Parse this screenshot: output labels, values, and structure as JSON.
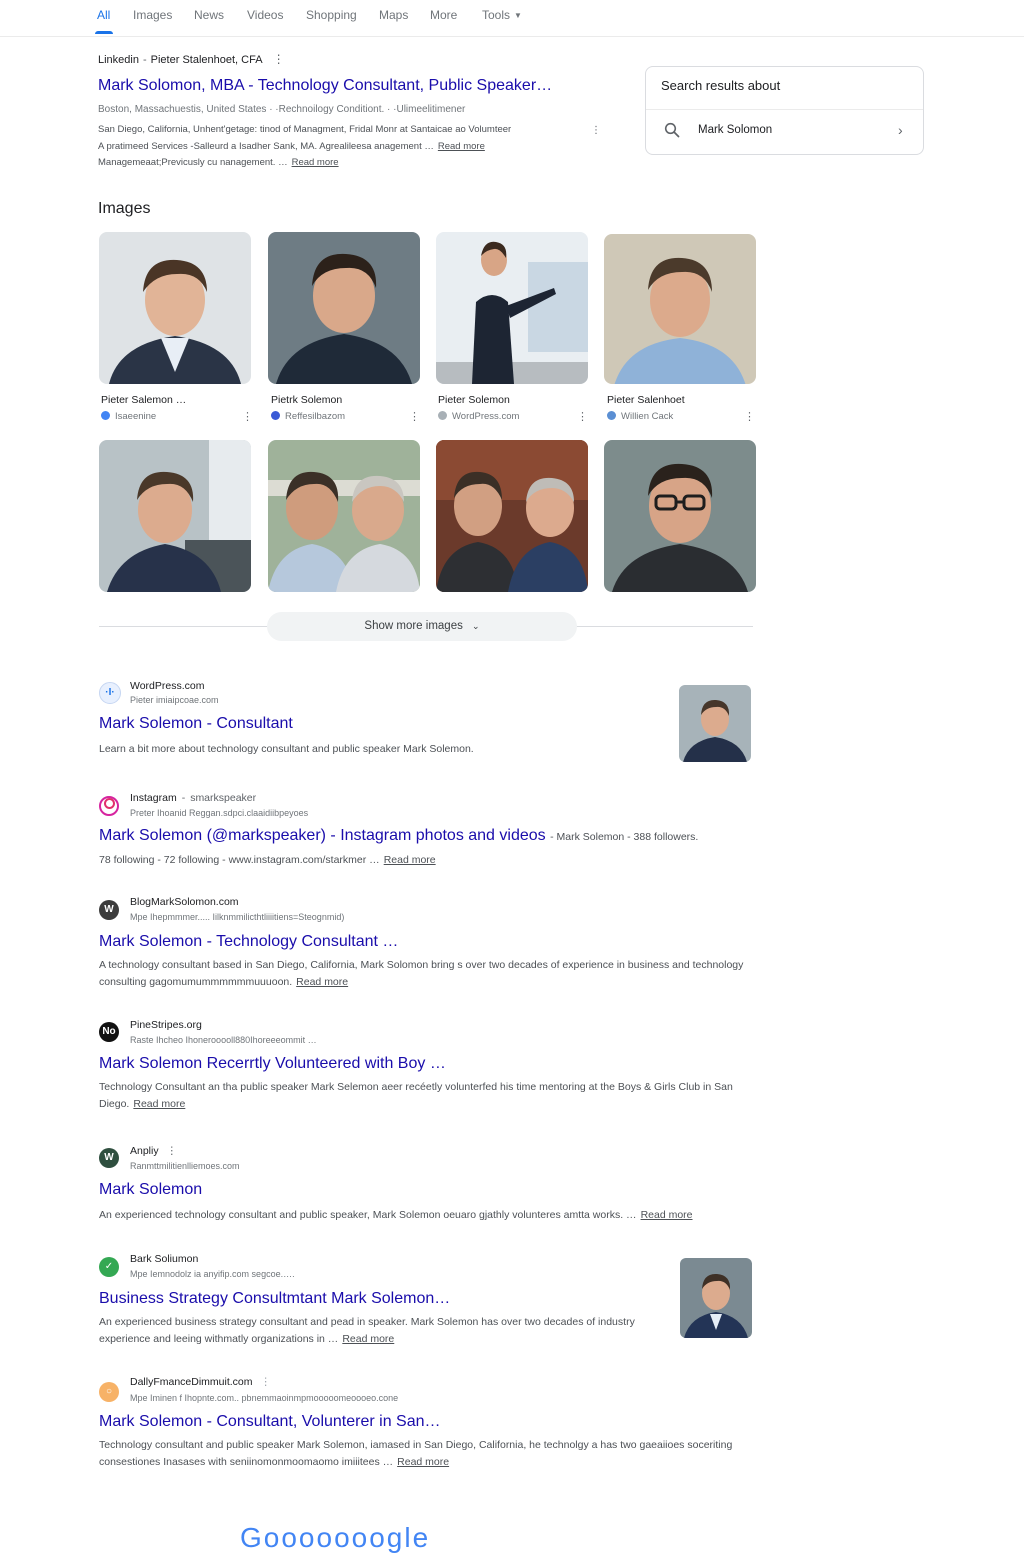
{
  "tabs": [
    {
      "label": "All"
    },
    {
      "label": "Images"
    },
    {
      "label": "News"
    },
    {
      "label": "Videos"
    },
    {
      "label": "Shopping"
    },
    {
      "label": "Maps"
    },
    {
      "label": "More"
    },
    {
      "label": "Tools"
    }
  ],
  "first_result": {
    "site": "Linkedin",
    "sub": "Pieter Stalenhoet, CFA",
    "title": "Mark Solomon, MBA - Technology Consultant, Public Speaker…",
    "meta": "Boston, Massachuestis, United States · ·Rechnoilogy Conditiont. · ·Ulimeelitimener",
    "line1": "San Diego, California, Unhent'getage: tinod of Managment, Fridal Monr at Santaicae ao Volumteer",
    "line2": "A pratimeed Services -Salleurd a Isadher Sank, MA. Agrealileesa anagement …",
    "line2_more": "Read more",
    "line3": "Managemeaat;Previcusly cu nanagement. …",
    "line3_more": "Read more"
  },
  "knowledge_box": {
    "title": "Search results about",
    "query": "Mark Solomon"
  },
  "images_section": {
    "title": "Images",
    "captions": [
      {
        "title": "Pieter Salemon …",
        "source": "Isaeenine"
      },
      {
        "title": "Pietrk Solemon",
        "source": "Reffesilbazom"
      },
      {
        "title": "Pieter Solemon",
        "source": "WordPress.com"
      },
      {
        "title": "Pieter Salenhoet",
        "source": "Willien Cack"
      }
    ],
    "show_more": "Show more images"
  },
  "results": [
    {
      "site": "WordPress.com",
      "url": "Pieter imiaipcoae.com",
      "title": "Mark Solemon - Consultant",
      "text": "Learn a bit more about technology consultant and public speaker Mark Solemon.",
      "more": ""
    },
    {
      "site": "Instagram",
      "handle": "smarkspeaker",
      "url": "Preter Ihoanid Reggan.sdpci.claaidiibpeyoes",
      "title": "Mark Solemon (@markspeaker) - Instagram photos and videos",
      "title_suffix": "- Mark Solemon - 388 followers.",
      "text": "78 following - 72 following - www.instagram.com/starkmer …",
      "more": "Read more"
    },
    {
      "site": "BlogMarkSolomon.com",
      "url": "Mpe Ihepmmmer..... Iilknmmilicthtliiiitiens=Steognmid)",
      "title": "Mark Solemon - Technology Consultant …",
      "text": "A technology consultant based in San Diego, California, Mark Solomon bring s over two decades of experience in business and technology consulting gagomumummmmmmuuuoon.",
      "more": "Read more"
    },
    {
      "site": "PineStripes.org",
      "url": "Raste Ihcheo Ihonerooooll880Ihoreeeommit …",
      "title": "Mark Solemon Recerrtly Volunteered with Boy …",
      "text": "Technology Consultant an tha public speaker Mark Selemon aeer recéetly volunterfed his time mentoring at the Boys & Girls Club in San Diego.",
      "more": "Read more"
    },
    {
      "site": "Anpliy",
      "url": "Ranmttmilitienlliemoes.com",
      "title": "Mark Solemon",
      "text": "An experienced technology consultant and public speaker, Mark Solemon oeuaro gjathly volunteres amtta works. …",
      "more": "Read more"
    },
    {
      "site": "Bark Soliumon",
      "url": "Mpe Iemnodolz ia anyifip.com segcoe.….",
      "title": "Business Strategy Consultmtant Mark Solemon…",
      "text": "An experienced business strategy consultant and pead in speaker. Mark Solemon has over two decades of industry experience and leeing withmatly organizations in …",
      "more": "Read more"
    },
    {
      "site": "DallyFmanceDimmuit.com",
      "url": "Mpe Iminen f Ihopnte.com.. pbnemmaoinmpmooooomeoooeo.cone",
      "title": "Mark Solemon - Consultant, Volunterer in San…",
      "text": "Technology consultant and public speaker Mark Solemon, iamased in San Diego, California, he technolgy a has two gaeaiioes soceriting consestiones Inasases with seniinomonmoomaomo imiiitees …",
      "more": "Read more"
    }
  ],
  "footer": {
    "logo_text": "Gooooooogle"
  },
  "colors": {
    "link": "#1a0dab",
    "accent": "#1a73e8",
    "text_secondary": "#4d5156"
  },
  "icons": {
    "search": "magnifier",
    "chevron": "chevron-right",
    "more": "chevron-down"
  }
}
